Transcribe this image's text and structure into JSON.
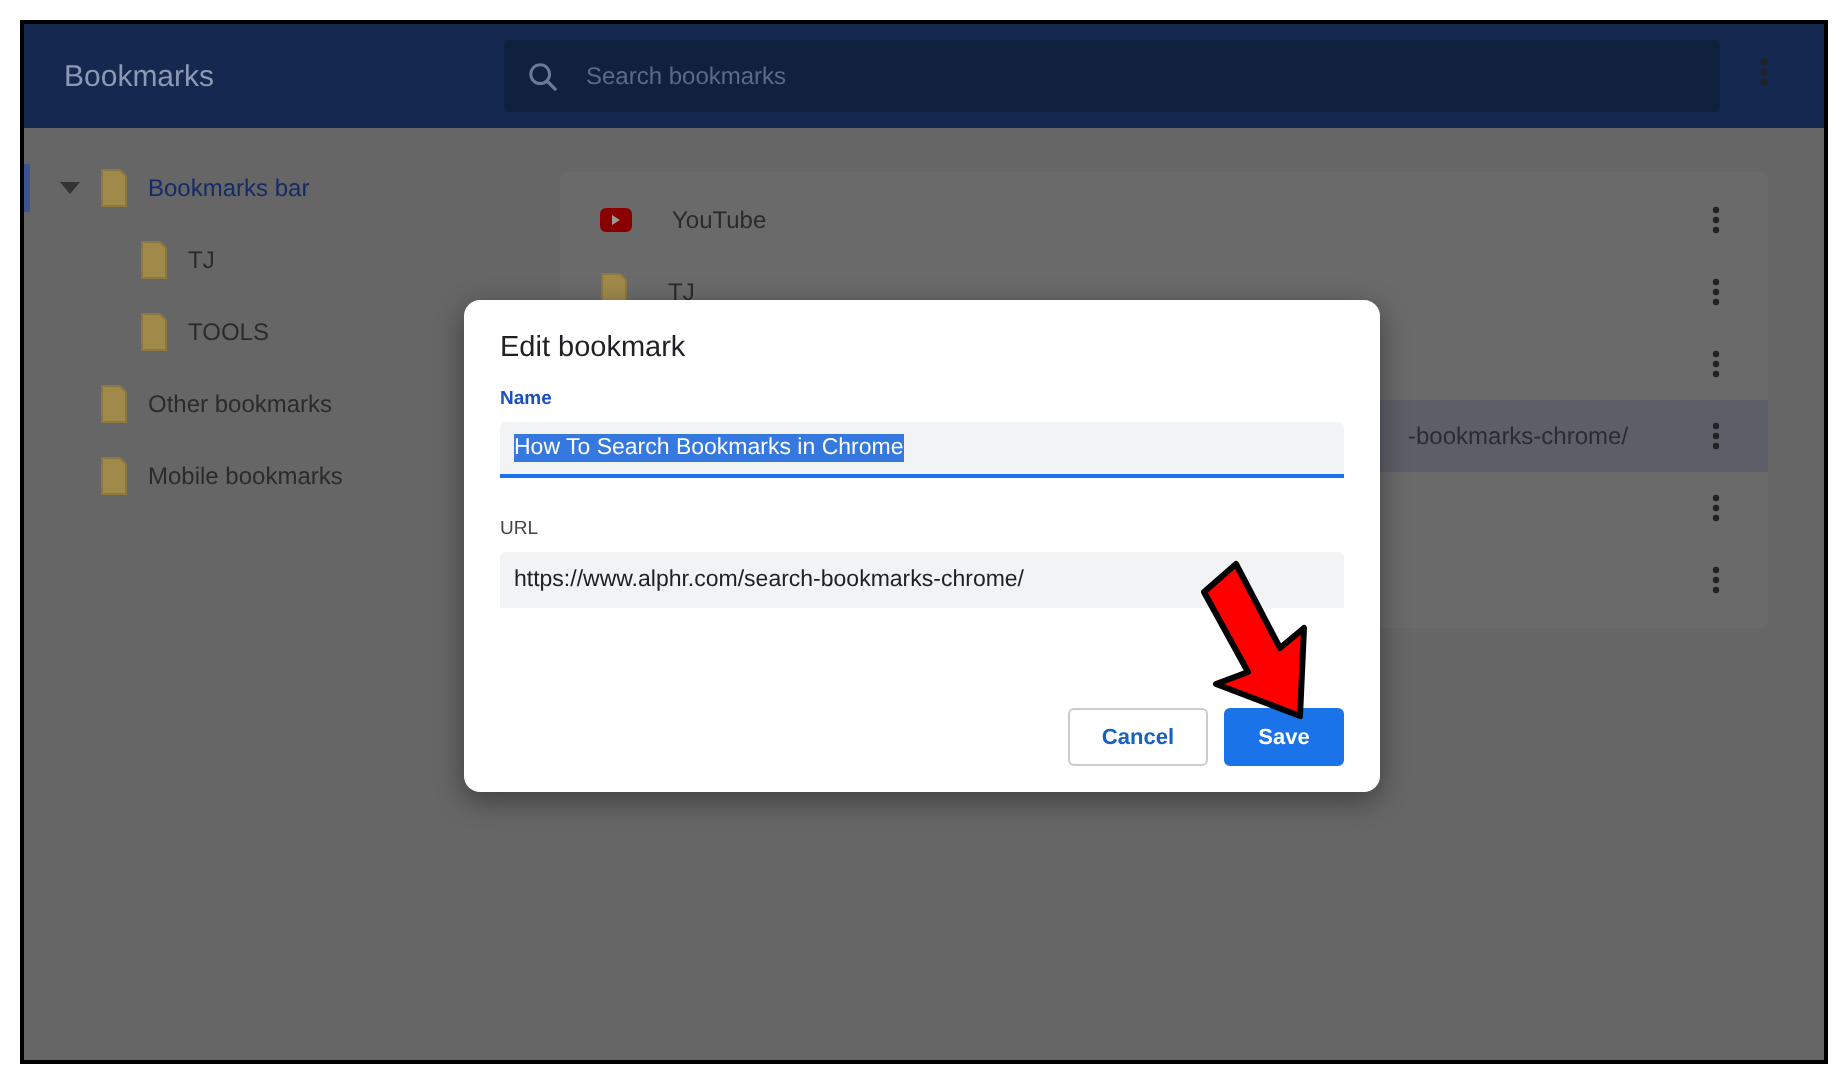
{
  "header": {
    "title": "Bookmarks",
    "search": {
      "placeholder": "Search bookmarks"
    }
  },
  "sidebar": {
    "items": [
      {
        "label": "Bookmarks bar",
        "selected": true,
        "expanded": true,
        "children": [
          {
            "label": "TJ",
            "selected": false
          },
          {
            "label": "TOOLS",
            "selected": false
          }
        ]
      },
      {
        "label": "Other bookmarks",
        "selected": false
      },
      {
        "label": "Mobile bookmarks",
        "selected": false
      }
    ]
  },
  "list": {
    "rows": [
      {
        "kind": "site",
        "title": "YouTube",
        "selected": false
      },
      {
        "kind": "folder",
        "title": "TJ",
        "selected": false
      },
      {
        "kind": "hidden",
        "selected": false
      },
      {
        "kind": "cut",
        "title": "-bookmarks-chrome/",
        "selected": true
      },
      {
        "kind": "hidden",
        "selected": false
      },
      {
        "kind": "hidden",
        "selected": false
      }
    ]
  },
  "dialog": {
    "title": "Edit bookmark",
    "fields": [
      {
        "label": "Name",
        "value": "How To Search Bookmarks in Chrome",
        "focused": true,
        "text_selected": true
      },
      {
        "label": "URL",
        "value": "https://www.alphr.com/search-bookmarks-chrome/",
        "focused": false,
        "text_selected": false
      }
    ],
    "buttons": [
      {
        "label": "Cancel",
        "kind": "secondary"
      },
      {
        "label": "Save",
        "kind": "primary"
      }
    ]
  }
}
